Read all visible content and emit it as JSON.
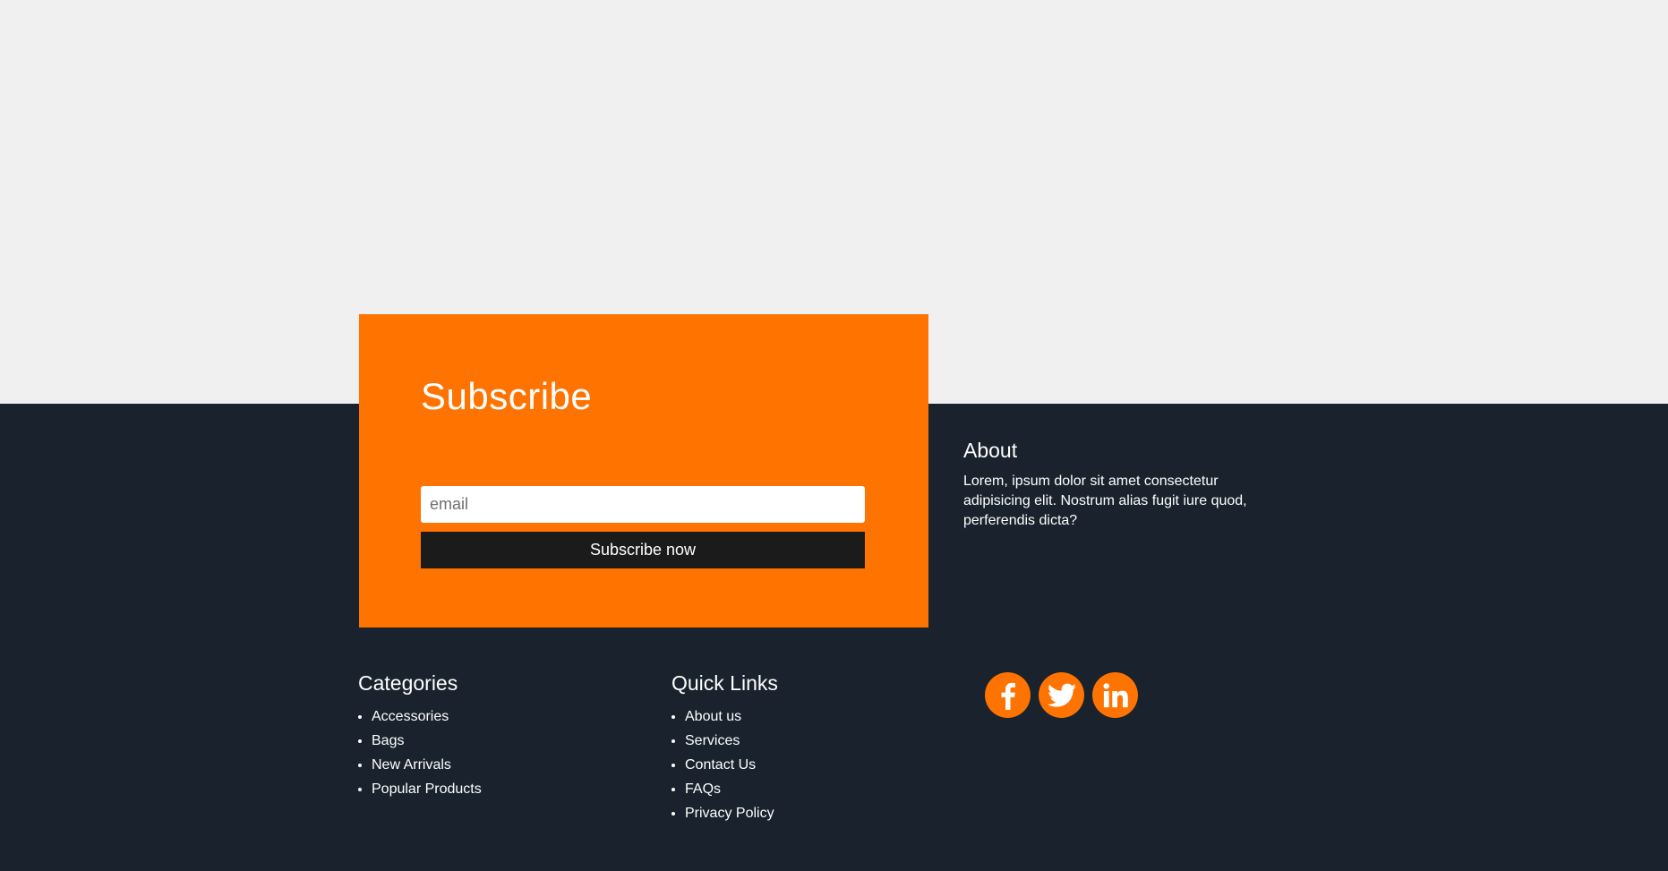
{
  "subscribe": {
    "title": "Subscribe",
    "email_placeholder": "email",
    "button_label": "Subscribe now"
  },
  "about": {
    "title": "About",
    "text": "Lorem, ipsum dolor sit amet consectetur adipisicing elit. Nostrum alias fugit iure quod, perferendis dicta?"
  },
  "categories": {
    "title": "Categories",
    "items": [
      "Accessories",
      "Bags",
      "New Arrivals",
      "Popular Products"
    ]
  },
  "quick_links": {
    "title": "Quick Links",
    "items": [
      "About us",
      "Services",
      "Contact Us",
      "FAQs",
      "Privacy Policy"
    ]
  },
  "social": {
    "icons": [
      "facebook-icon",
      "twitter-icon",
      "linkedin-icon"
    ]
  },
  "colors": {
    "accent": "#ff7301",
    "footer_bg": "#19222d",
    "page_bg": "#f0f0f0",
    "button_bg": "#1b1b1b"
  }
}
